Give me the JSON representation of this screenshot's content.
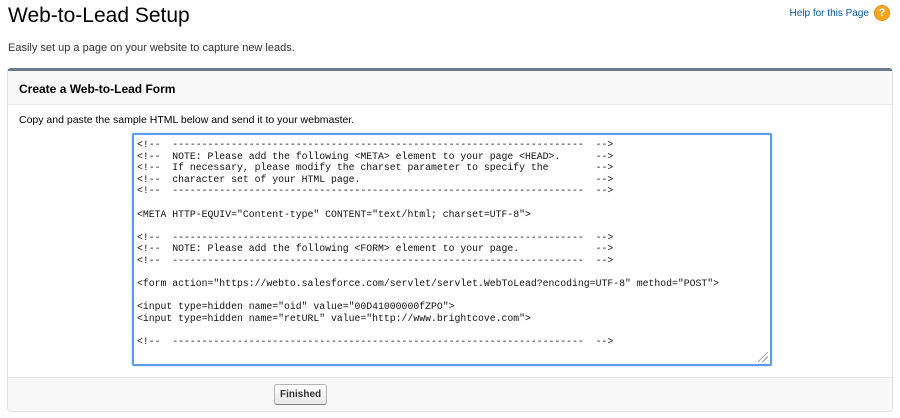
{
  "page": {
    "title": "Web-to-Lead Setup",
    "help_label": "Help for this Page",
    "help_icon": "question-mark-icon",
    "help_icon_glyph": "?",
    "intro": "Easily set up a page on your website to capture new leads."
  },
  "panel": {
    "title": "Create a Web-to-Lead Form",
    "instructions": "Copy and paste the sample HTML below and send it to your webmaster.",
    "code": "<!--  ----------------------------------------------------------------------  -->\n<!--  NOTE: Please add the following <META> element to your page <HEAD>.      -->\n<!--  If necessary, please modify the charset parameter to specify the        -->\n<!--  character set of your HTML page.                                        -->\n<!--  ----------------------------------------------------------------------  -->\n\n<META HTTP-EQUIV=\"Content-type\" CONTENT=\"text/html; charset=UTF-8\">\n\n<!--  ----------------------------------------------------------------------  -->\n<!--  NOTE: Please add the following <FORM> element to your page.             -->\n<!--  ----------------------------------------------------------------------  -->\n\n<form action=\"https://webto.salesforce.com/servlet/servlet.WebToLead?encoding=UTF-8\" method=\"POST\">\n\n<input type=hidden name=\"oid\" value=\"00D41000000fZPO\">\n<input type=hidden name=\"retURL\" value=\"http://www.brightcove.com\">\n\n<!--  ----------------------------------------------------------------------  -->",
    "finished_label": "Finished"
  },
  "colors": {
    "link": "#015ba7",
    "help_icon": "#f5a623",
    "panel_border_top": "#6b7b89",
    "focus_border": "#5b9bf0"
  }
}
